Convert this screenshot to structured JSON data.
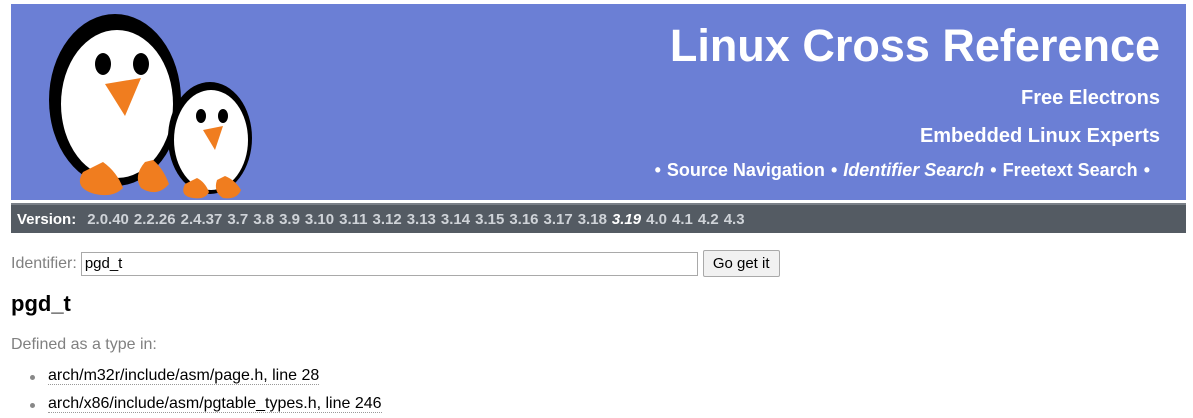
{
  "header": {
    "title": "Linux Cross Reference",
    "subtitle1": "Free Electrons",
    "subtitle2": "Embedded Linux Experts",
    "nav": [
      {
        "label": "Source Navigation",
        "current": false
      },
      {
        "label": "Identifier Search",
        "current": true
      },
      {
        "label": "Freetext Search",
        "current": false
      }
    ],
    "bullet": "•",
    "color": "#6b7fd5"
  },
  "versions": {
    "label": "Version:",
    "items": [
      "2.0.40",
      "2.2.26",
      "2.4.37",
      "3.7",
      "3.8",
      "3.9",
      "3.10",
      "3.11",
      "3.12",
      "3.13",
      "3.14",
      "3.15",
      "3.16",
      "3.17",
      "3.18",
      "3.19",
      "4.0",
      "4.1",
      "4.2",
      "4.3"
    ],
    "current": "3.19",
    "bar_color": "#545b63"
  },
  "search": {
    "label": "Identifier:",
    "value": "pgd_t",
    "button": "Go get it"
  },
  "result": {
    "identifier": "pgd_t",
    "defined_label": "Defined as a type in:",
    "items": [
      "arch/m32r/include/asm/page.h, line 28",
      "arch/x86/include/asm/pgtable_types.h, line 246"
    ]
  }
}
